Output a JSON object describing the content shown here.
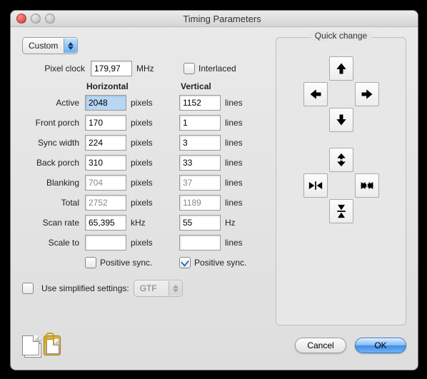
{
  "window_title": "Timing Parameters",
  "preset_select": "Custom",
  "pixel_clock": {
    "label": "Pixel clock",
    "value": "179,97",
    "unit": "MHz"
  },
  "interlaced": {
    "label": "Interlaced",
    "checked": false
  },
  "columns": {
    "horizontal": "Horizontal",
    "vertical": "Vertical"
  },
  "rows": {
    "active": {
      "label": "Active",
      "h": "2048",
      "h_unit": "pixels",
      "v": "1152",
      "v_unit": "lines",
      "h_selected": true
    },
    "front_porch": {
      "label": "Front porch",
      "h": "170",
      "h_unit": "pixels",
      "v": "1",
      "v_unit": "lines"
    },
    "sync_width": {
      "label": "Sync width",
      "h": "224",
      "h_unit": "pixels",
      "v": "3",
      "v_unit": "lines"
    },
    "back_porch": {
      "label": "Back porch",
      "h": "310",
      "h_unit": "pixels",
      "v": "33",
      "v_unit": "lines"
    },
    "blanking": {
      "label": "Blanking",
      "h": "704",
      "h_unit": "pixels",
      "v": "37",
      "v_unit": "lines",
      "dim": true
    },
    "total": {
      "label": "Total",
      "h": "2752",
      "h_unit": "pixels",
      "v": "1189",
      "v_unit": "lines",
      "dim": true
    },
    "scan_rate": {
      "label": "Scan rate",
      "h": "65,395",
      "h_unit": "kHz",
      "v": "55",
      "v_unit": "Hz"
    },
    "scale_to": {
      "label": "Scale to",
      "h": "",
      "h_unit": "pixels",
      "v": "",
      "v_unit": "lines"
    }
  },
  "positive_sync": {
    "label": "Positive sync.",
    "h_checked": false,
    "v_checked": true
  },
  "simplified": {
    "label": "Use simplified settings:",
    "checked": false,
    "select": "GTF"
  },
  "quick_change_title": "Quick change",
  "footer": {
    "cancel": "Cancel",
    "ok": "OK"
  }
}
